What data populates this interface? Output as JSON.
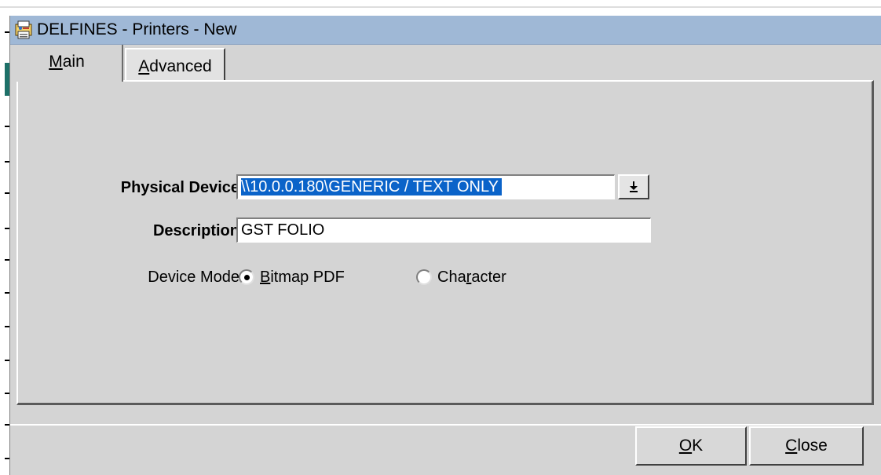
{
  "window": {
    "title": "DELFINES - Printers - New",
    "icon": "printer-app-icon"
  },
  "tabs": [
    {
      "label_pre": "",
      "label_ul": "M",
      "label_post": "ain",
      "selected": true
    },
    {
      "label_pre": "",
      "label_ul": "A",
      "label_post": "dvanced",
      "selected": false
    }
  ],
  "form": {
    "physical_device_label": "Physical Device",
    "physical_device_value": "\\\\10.0.0.180\\GENERIC / TEXT ONLY",
    "description_label": "Description",
    "description_value": "GST FOLIO",
    "device_mode_label": "Device Mode",
    "device_mode_options": [
      {
        "pre": "",
        "ul": "B",
        "post": "itmap PDF",
        "selected": true
      },
      {
        "pre": "Cha",
        "ul": "r",
        "post": "acter",
        "selected": false
      }
    ],
    "dropdown_icon": "down-arrow-icon"
  },
  "buttons": {
    "ok": {
      "pre": "",
      "ul": "O",
      "post": "K"
    },
    "close": {
      "pre": "",
      "ul": "C",
      "post": "lose"
    }
  },
  "colors": {
    "titlebar": "#9fb8d6",
    "dialog_bg": "#d4d4d4",
    "selection": "#0a63c9"
  }
}
